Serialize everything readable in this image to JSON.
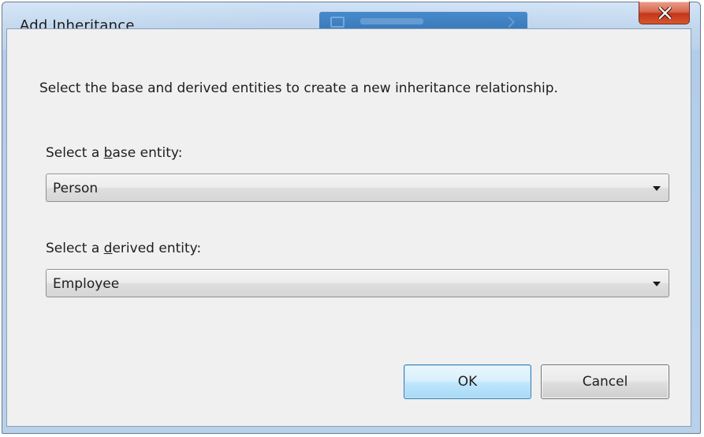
{
  "dialog": {
    "title": "Add Inheritance",
    "description": "Select the base and derived entities to create a new inheritance relationship."
  },
  "base_entity": {
    "label_prefix": "Select a ",
    "label_accel": "b",
    "label_suffix": "ase entity:",
    "selected": "Person"
  },
  "derived_entity": {
    "label_prefix": "Select a ",
    "label_accel": "d",
    "label_suffix": "erived entity:",
    "selected": "Employee"
  },
  "buttons": {
    "ok": "OK",
    "cancel": "Cancel"
  },
  "icons": {
    "close": "close-icon",
    "dropdown": "chevron-down-icon"
  },
  "colors": {
    "title_bar": "#b9d1ea",
    "close_button": "#c7391d",
    "dialog_body": "#f0f0f0",
    "ok_button_border": "#3c7fb1"
  }
}
